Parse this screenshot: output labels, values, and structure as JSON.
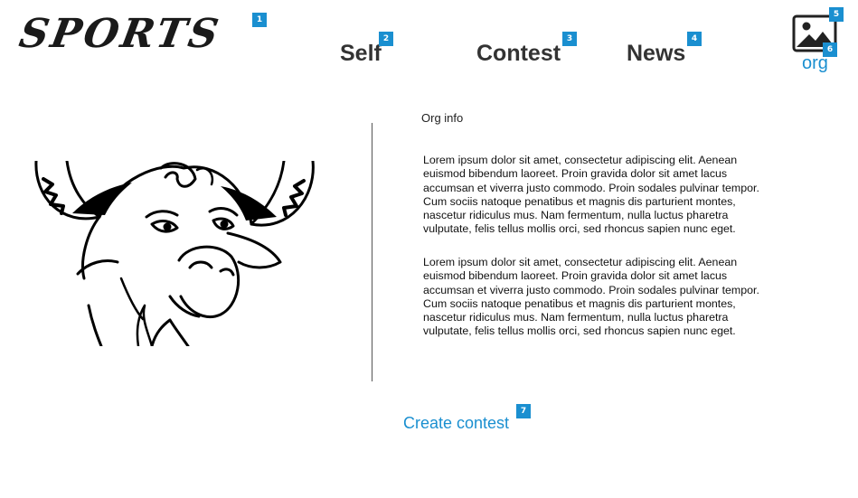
{
  "header": {
    "logo_text": "SPORTS",
    "nav": [
      {
        "label": "Self"
      },
      {
        "label": "Contest"
      },
      {
        "label": "News"
      }
    ],
    "org_label": "org"
  },
  "badges": [
    "1",
    "2",
    "3",
    "4",
    "5",
    "6",
    "7"
  ],
  "main": {
    "section_title": "Org info",
    "paragraphs": [
      "Lorem ipsum dolor sit amet, consectetur adipiscing elit. Aenean euismod bibendum laoreet. Proin gravida dolor sit amet lacus accumsan et viverra justo commodo. Proin sodales pulvinar tempor. Cum sociis natoque penatibus et magnis dis parturient montes, nascetur ridiculus mus. Nam fermentum, nulla luctus pharetra vulputate, felis tellus mollis orci, sed rhoncus sapien nunc eget.",
      "Lorem ipsum dolor sit amet, consectetur adipiscing elit. Aenean euismod bibendum laoreet. Proin gravida dolor sit amet lacus accumsan et viverra justo commodo. Proin sodales pulvinar tempor. Cum sociis natoque penatibus et magnis dis parturient montes, nascetur ridiculus mus. Nam fermentum, nulla luctus pharetra vulputate, felis tellus mollis orci, sed rhoncus sapien nunc eget."
    ],
    "create_button": "Create contest"
  },
  "icons": {
    "org_avatar": "image-placeholder-icon",
    "org_logo": "gnu-head-icon"
  },
  "colors": {
    "accent": "#1a8fd0",
    "nav_text": "#333333"
  }
}
